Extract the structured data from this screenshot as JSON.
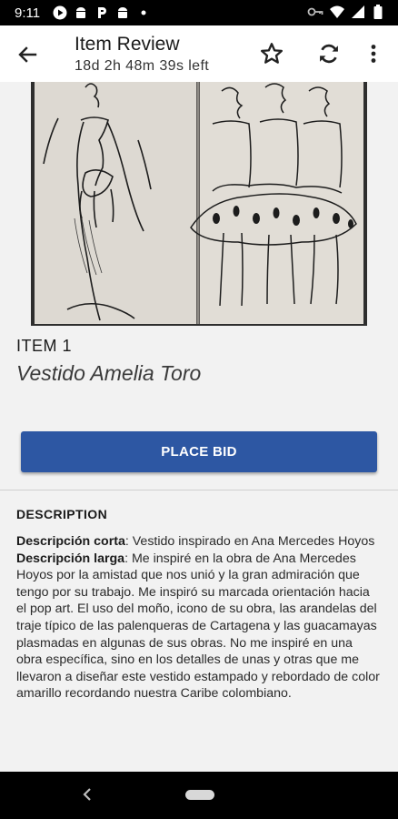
{
  "status_bar": {
    "time": "9:11",
    "left_icons": [
      "play-icon",
      "android-icon",
      "p-icon",
      "android-icon",
      "dot-icon"
    ],
    "right_icons": [
      "key-icon",
      "wifi-icon",
      "signal-icon",
      "battery-icon"
    ]
  },
  "app_bar": {
    "title": "Item Review",
    "subtitle": "18d 2h 48m 39s left",
    "icons": [
      "back-arrow-icon",
      "star-icon",
      "refresh-icon",
      "more-vert-icon"
    ]
  },
  "item": {
    "number_label": "ITEM 1",
    "name": "Vestido Amelia Toro",
    "image_alt": "sketchbook fashion drawings"
  },
  "bid_button": {
    "label": "PLACE BID"
  },
  "description": {
    "heading": "DESCRIPTION",
    "short_label": "Descripción corta",
    "short_text": ": Vestido inspirado en Ana Mercedes Hoyos",
    "long_label": "Descripción larga",
    "long_text": ": Me inspiré en la obra de Ana Mercedes Hoyos por la amistad que nos unió y la gran admiración que tengo por su trabajo. Me inspiró su marcada orientación hacia el pop art. El uso del moño, icono de su obra, las arandelas del traje típico de las palenqueras de Cartagena y las guacamayas plasmadas en algunas de sus obras. No me inspiré en una obra específica, sino en los detalles de unas y otras que me llevaron a diseñar este vestido estampado y rebordado de color amarillo recordando nuestra Caribe colombiano."
  },
  "colors": {
    "accent": "#2d57a3",
    "background": "#f2f2f2",
    "app_bar": "#ffffff",
    "system_bars": "#000000"
  }
}
